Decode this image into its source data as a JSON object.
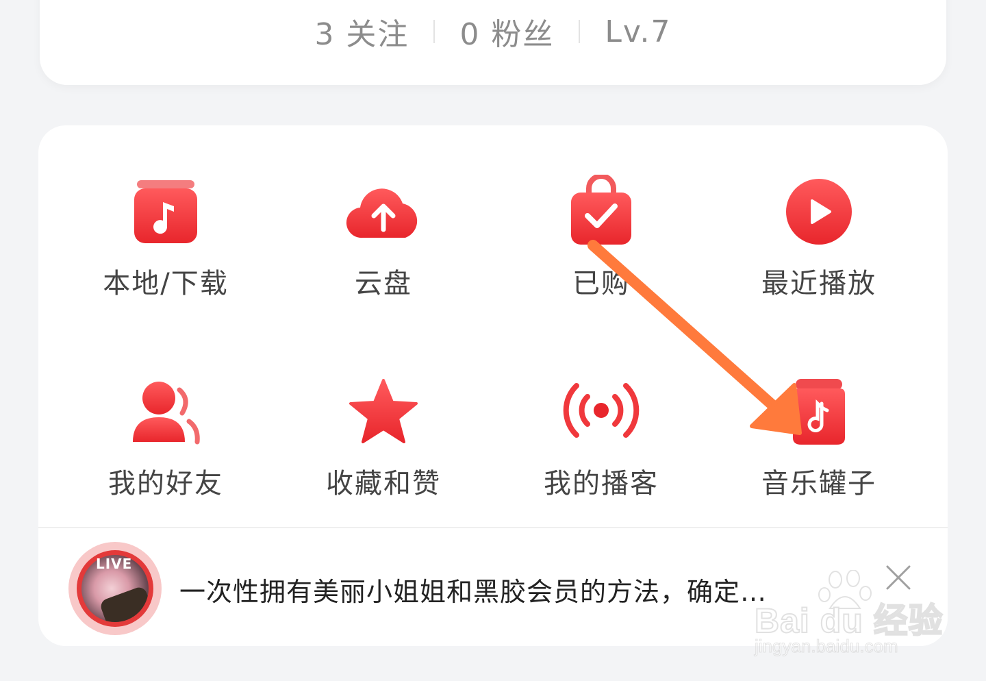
{
  "profile_stats": {
    "following": "3 关注",
    "followers": "0 粉丝",
    "level": "Lv.7"
  },
  "grid": {
    "items": [
      {
        "label": "本地/下载",
        "icon": "local-download-icon"
      },
      {
        "label": "云盘",
        "icon": "cloud-upload-icon"
      },
      {
        "label": "已购",
        "icon": "purchased-bag-icon"
      },
      {
        "label": "最近播放",
        "icon": "play-circle-icon"
      },
      {
        "label": "我的好友",
        "icon": "friends-icon"
      },
      {
        "label": "收藏和赞",
        "icon": "star-icon"
      },
      {
        "label": "我的播客",
        "icon": "podcast-broadcast-icon"
      },
      {
        "label": "音乐罐子",
        "icon": "music-jar-icon"
      }
    ]
  },
  "banner": {
    "badge": "LIVE",
    "text": "一次性拥有美丽小姐姐和黑胶会员的方法，确定…"
  },
  "watermark": {
    "brand": "Bai du 经验",
    "url": "jingyan.baidu.com"
  },
  "colors": {
    "accent_red": "#f03a3e",
    "arrow_orange": "#ff7a3c",
    "text_gray": "#8c8c8c",
    "label_gray": "#444444"
  }
}
